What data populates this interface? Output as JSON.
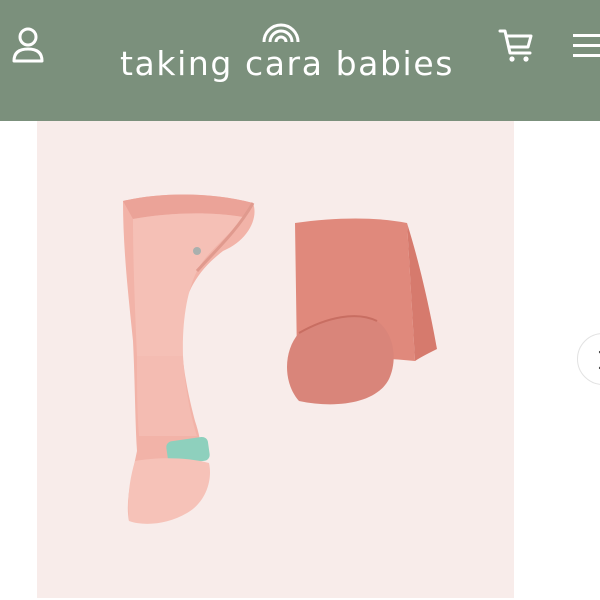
{
  "header": {
    "brand_name": "taking cara babies",
    "background_color": "#7b907c",
    "account_icon": "user-icon",
    "cart_icon": "cart-icon",
    "menu_icon": "hamburger-menu-icon"
  },
  "product_gallery": {
    "image": "pink swaddle with matching pink wrap blanket",
    "next_icon": "chevron-right-icon"
  }
}
